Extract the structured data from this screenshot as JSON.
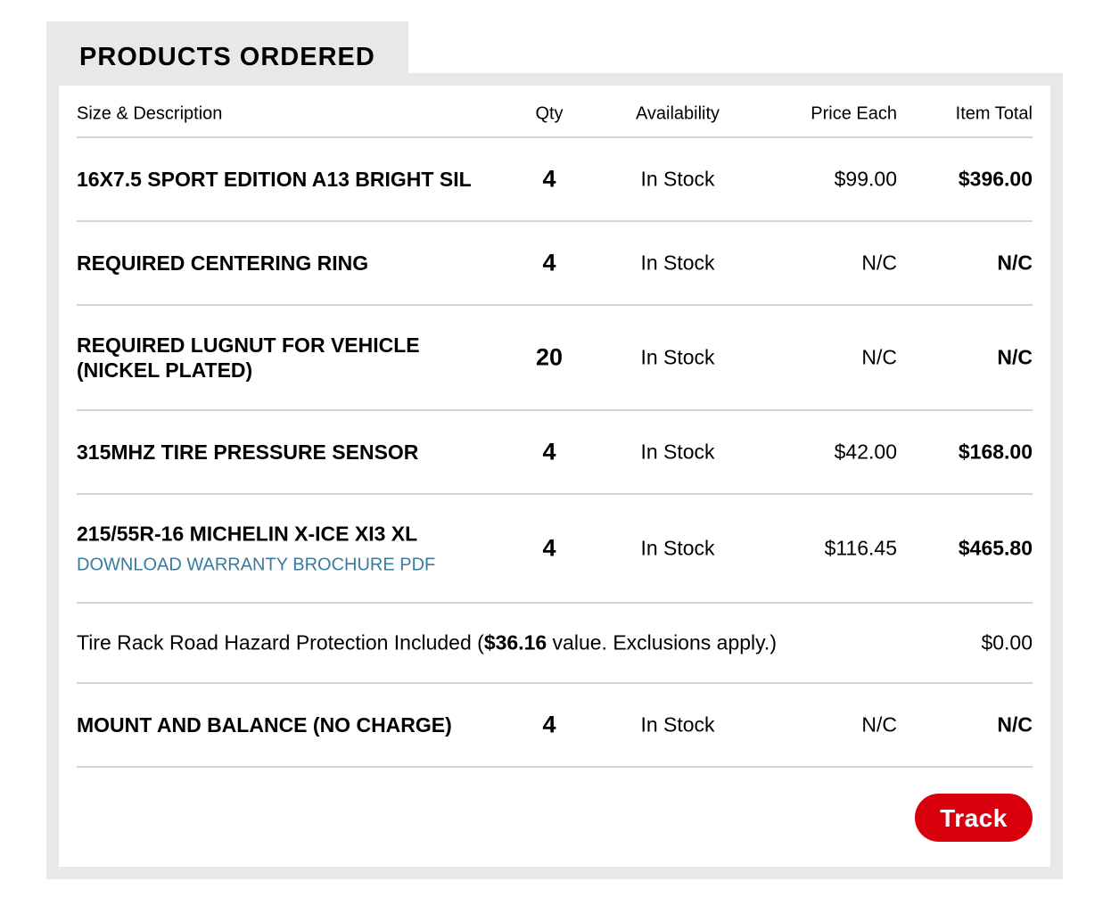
{
  "section": {
    "title": "PRODUCTS ORDERED"
  },
  "columns": {
    "description": "Size & Description",
    "qty": "Qty",
    "availability": "Availability",
    "price_each": "Price Each",
    "item_total": "Item Total"
  },
  "items": [
    {
      "description": "16X7.5 SPORT EDITION A13 BRIGHT SIL",
      "qty": "4",
      "availability": "In Stock",
      "price_each": "$99.00",
      "item_total": "$396.00"
    },
    {
      "description": "REQUIRED CENTERING RING",
      "qty": "4",
      "availability": "In Stock",
      "price_each": "N/C",
      "item_total": "N/C"
    },
    {
      "description": "REQUIRED LUGNUT FOR VEHICLE (NICKEL PLATED)",
      "qty": "20",
      "availability": "In Stock",
      "price_each": "N/C",
      "item_total": "N/C"
    },
    {
      "description": "315MHZ TIRE PRESSURE SENSOR",
      "qty": "4",
      "availability": "In Stock",
      "price_each": "$42.00",
      "item_total": "$168.00"
    },
    {
      "description": "215/55R-16 MICHELIN X-ICE XI3 XL",
      "link": "DOWNLOAD WARRANTY BROCHURE PDF",
      "qty": "4",
      "availability": "In Stock",
      "price_each": "$116.45",
      "item_total": "$465.80"
    },
    {
      "description": "MOUNT AND BALANCE (NO CHARGE)",
      "qty": "4",
      "availability": "In Stock",
      "price_each": "N/C",
      "item_total": "N/C"
    }
  ],
  "protection": {
    "text_before": "Tire Rack Road Hazard Protection Included (",
    "value": "$36.16",
    "text_after": " value. Exclusions apply.)",
    "item_total": "$0.00"
  },
  "actions": {
    "track_label": "Track"
  },
  "colors": {
    "accent_red": "#d9000d",
    "link_blue": "#3a7a9c",
    "frame_gray": "#e8e8e8"
  }
}
